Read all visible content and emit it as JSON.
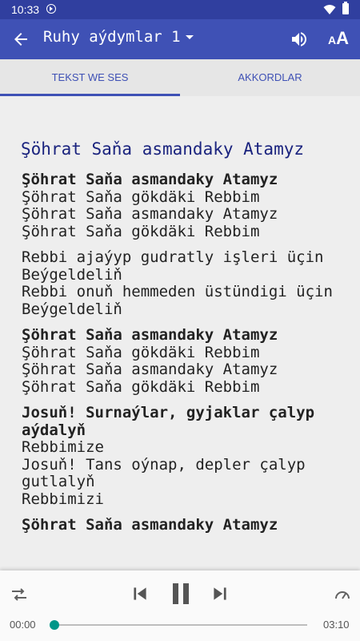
{
  "status_bar": {
    "time": "10:33"
  },
  "toolbar": {
    "title": "Ruhy aýdymlar 1",
    "font_size_small": "A",
    "font_size_big": "A"
  },
  "tabs": [
    {
      "label": "TEKST WE SES",
      "selected": true
    },
    {
      "label": "AKKORDLAR",
      "selected": false
    }
  ],
  "song": {
    "title": "Şöhrat Saňa asmandaky Atamyz",
    "stanzas": [
      {
        "lines": [
          {
            "text": "Şöhrat Saňa asmandaky Atamyz",
            "bold": true
          },
          {
            "text": "Şöhrat Saňa gökdäki Rebbim",
            "bold": false
          },
          {
            "text": "Şöhrat Saňa asmandaky Atamyz",
            "bold": false
          },
          {
            "text": "Şöhrat Saňa gökdäki Rebbim",
            "bold": false
          }
        ]
      },
      {
        "lines": [
          {
            "text": "Rebbi ajaýyp gudratly işleri üçin",
            "bold": false
          },
          {
            "text": "Beýgeldeliň",
            "bold": false
          },
          {
            "text": "Rebbi onuň hemmeden üstündigi üçin",
            "bold": false
          },
          {
            "text": "Beýgeldeliň",
            "bold": false
          }
        ]
      },
      {
        "lines": [
          {
            "text": "Şöhrat Saňa asmandaky Atamyz",
            "bold": true
          },
          {
            "text": "Şöhrat Saňa gökdäki Rebbim",
            "bold": false
          },
          {
            "text": "Şöhrat Saňa asmandaky Atamyz",
            "bold": false
          },
          {
            "text": "Şöhrat Saňa gökdäki Rebbim",
            "bold": false
          }
        ]
      },
      {
        "lines": [
          {
            "text": "Josuň! Surnaýlar, gyjaklar çalyp aýdalyň",
            "bold": true
          },
          {
            "text": "Rebbimize",
            "bold": false
          },
          {
            "text": "Josuň! Tans oýnap, depler çalyp gutlalyň",
            "bold": false
          },
          {
            "text": "Rebbimizi",
            "bold": false
          }
        ]
      },
      {
        "lines": [
          {
            "text": "Şöhrat Saňa asmandaky Atamyz",
            "bold": true
          }
        ]
      }
    ]
  },
  "player": {
    "current_time": "00:00",
    "total_time": "03:10",
    "progress": 0.0
  },
  "colors": {
    "primary": "#3f51b5",
    "primary_dark": "#303f9f",
    "accent": "#009688",
    "song_title": "#1a237e"
  },
  "icons": {
    "back": "arrow-left-icon",
    "dropdown": "caret-down-icon",
    "volume": "volume-icon",
    "font_size": "font-size-icon",
    "shuffle": "shuffle-icon",
    "previous": "skip-previous-icon",
    "pause": "pause-icon",
    "next": "skip-next-icon",
    "speed": "speed-icon"
  }
}
